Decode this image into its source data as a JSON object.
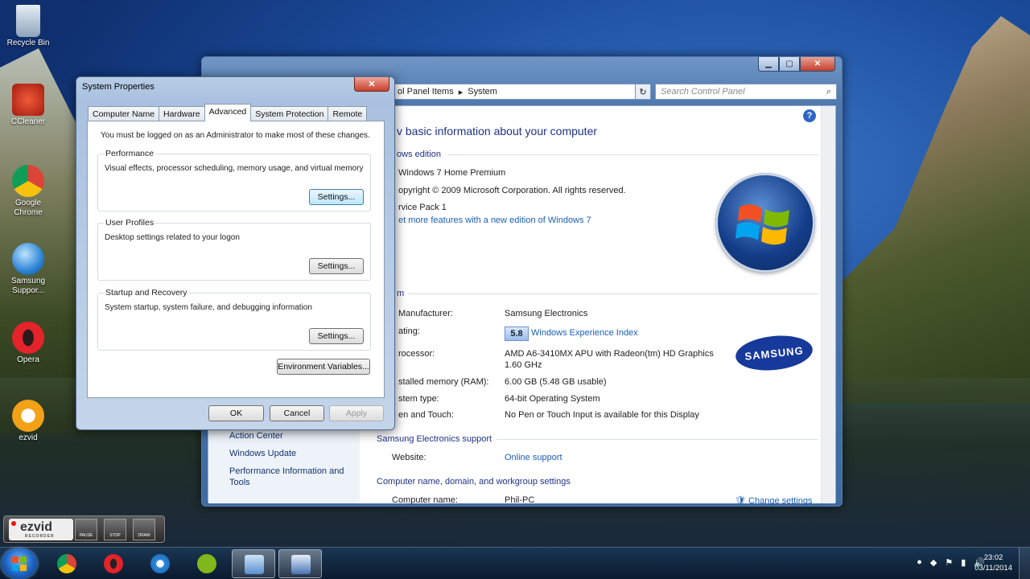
{
  "desktop_icons": [
    {
      "label": "Recycle Bin",
      "color": "#9fb3c8"
    },
    {
      "label": "CCleaner",
      "color": "#d43a2a"
    },
    {
      "label": "Google Chrome",
      "color": "#3aa047"
    },
    {
      "label": "Samsung Suppor...",
      "color": "#3a8fd8"
    },
    {
      "label": "Opera",
      "color": "#d61a1f"
    },
    {
      "label": "ezvid",
      "color": "#f3a117"
    }
  ],
  "control_panel": {
    "address": "ol Panel Items",
    "address_current": "System",
    "search_placeholder": "Search Control Panel",
    "heading": "v basic information about your computer",
    "windows_edition_title": "ows edition",
    "edition": "Windows 7 Home Premium",
    "copyright": "opyright © 2009 Microsoft Corporation.  All rights reserved.",
    "service_pack": "rvice Pack 1",
    "more_features_link": "et more features with a new edition of Windows 7",
    "system_section_title": "m",
    "rows": [
      {
        "label": "Manufacturer:",
        "value": "Samsung Electronics"
      },
      {
        "label": "ating:",
        "value": "Windows Experience Index"
      },
      {
        "label": "rocessor:",
        "value": "AMD A6-3410MX APU with Radeon(tm) HD Graphics",
        "value2": "1.60 GHz"
      },
      {
        "label": "stalled memory (RAM):",
        "value": "6.00 GB (5.48 GB usable)"
      },
      {
        "label": "stem type:",
        "value": "64-bit Operating System"
      },
      {
        "label": "en and Touch:",
        "value": "No Pen or Touch Input is available for this Display"
      }
    ],
    "wei_score": "5.8",
    "support_title": "Samsung Electronics support",
    "website_label": "Website:",
    "website_value": "Online support",
    "computer_name_title": "Computer name, domain, and workgroup settings",
    "computer_name_label": "Computer name:",
    "computer_name_value": "Phil-PC",
    "change_settings": "Change settings",
    "see_also": [
      "Action Center",
      "Windows Update",
      "Performance Information and Tools"
    ],
    "samsung_logo": "SAMSUNG"
  },
  "system_properties": {
    "title": "System Properties",
    "close_label": "✕",
    "tabs": [
      "Computer Name",
      "Hardware",
      "Advanced",
      "System Protection",
      "Remote"
    ],
    "active_tab": "Advanced",
    "admin_note": "You must be logged on as an Administrator to make most of these changes.",
    "groups": [
      {
        "title": "Performance",
        "desc": "Visual effects, processor scheduling, memory usage, and virtual memory",
        "button": "Settings..."
      },
      {
        "title": "User Profiles",
        "desc": "Desktop settings related to your logon",
        "button": "Settings..."
      },
      {
        "title": "Startup and Recovery",
        "desc": "System startup, system failure, and debugging information",
        "button": "Settings..."
      }
    ],
    "env_button": "Environment Variables...",
    "ok": "OK",
    "cancel": "Cancel",
    "apply": "Apply"
  },
  "ezvid": {
    "logo": "ezvid",
    "sub": "RECORDER",
    "buttons": [
      "PAUSE",
      "STOP",
      "DRAW"
    ]
  },
  "taskbar": {
    "apps": [
      "chrome",
      "opera",
      "internet-explorer",
      "spotify",
      "control-panel",
      "system-properties"
    ],
    "clock_time": "23:02",
    "clock_date": "03/11/2014"
  }
}
